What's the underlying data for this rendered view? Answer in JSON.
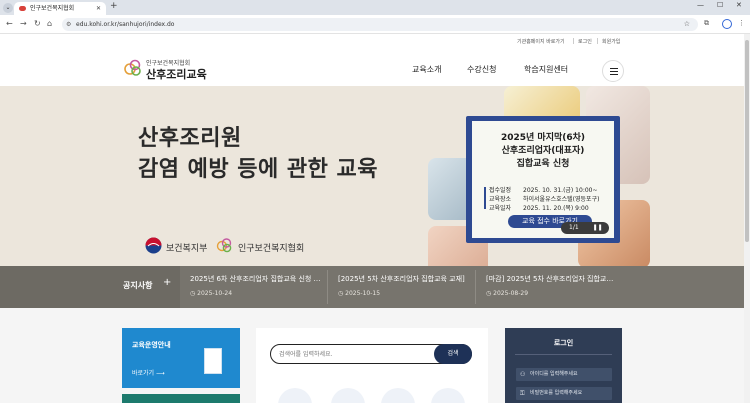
{
  "browser": {
    "tab_title": "인구보건복지협회",
    "url": "edu.kohi.or.kr/sanhujori/index.do"
  },
  "util_links": [
    "기관홈페이지 바로가기",
    "로그인",
    "회원가입"
  ],
  "logo": {
    "org": "인구보건복지협회",
    "title": "산후조리교육"
  },
  "menu": [
    "교육소개",
    "수강신청",
    "학습지원센터"
  ],
  "hero": {
    "line1": "산후조리원",
    "line2": "감염 예방 등에 관한 교육",
    "org1": "보건복지부",
    "org2": "인구보건복지협회"
  },
  "popup": {
    "line1": "2025년 마지막(6차)",
    "line2": "산후조리업자(대표자)",
    "line3": "집합교육 신청",
    "rows": [
      {
        "label": "접수일정",
        "value": "2025. 10. 31.(금) 10:00~"
      },
      {
        "label": "교육장소",
        "value": "하이서울유스호스텔(영등포구)"
      },
      {
        "label": "교육일자",
        "value": "2025. 11. 20.(목) 9:00"
      }
    ],
    "button": "교육 접수 바로가기",
    "pager": "1/1",
    "pause": "⏸"
  },
  "notice": {
    "label": "공지사항",
    "plus": "+",
    "items": [
      {
        "title": "2025년 6차 산후조리업자 집합교육 신청 …",
        "date": "2025-10-24"
      },
      {
        "title": "[2025년 5차 산후조리업자 집합교육 교재]",
        "date": "2025-10-15"
      },
      {
        "title": "[마감] 2025년 5차 산후조리업자 집합교…",
        "date": "2025-08-29"
      }
    ]
  },
  "edu_card": {
    "title": "교육운영안내",
    "more": "바로가기 ⟶"
  },
  "search": {
    "placeholder": "검색어를 입력하세요.",
    "button": "검색"
  },
  "login": {
    "title": "로그인",
    "id_placeholder": "아이디를 입력해주세요",
    "pw_placeholder": "비밀번호를 입력해주세요"
  }
}
